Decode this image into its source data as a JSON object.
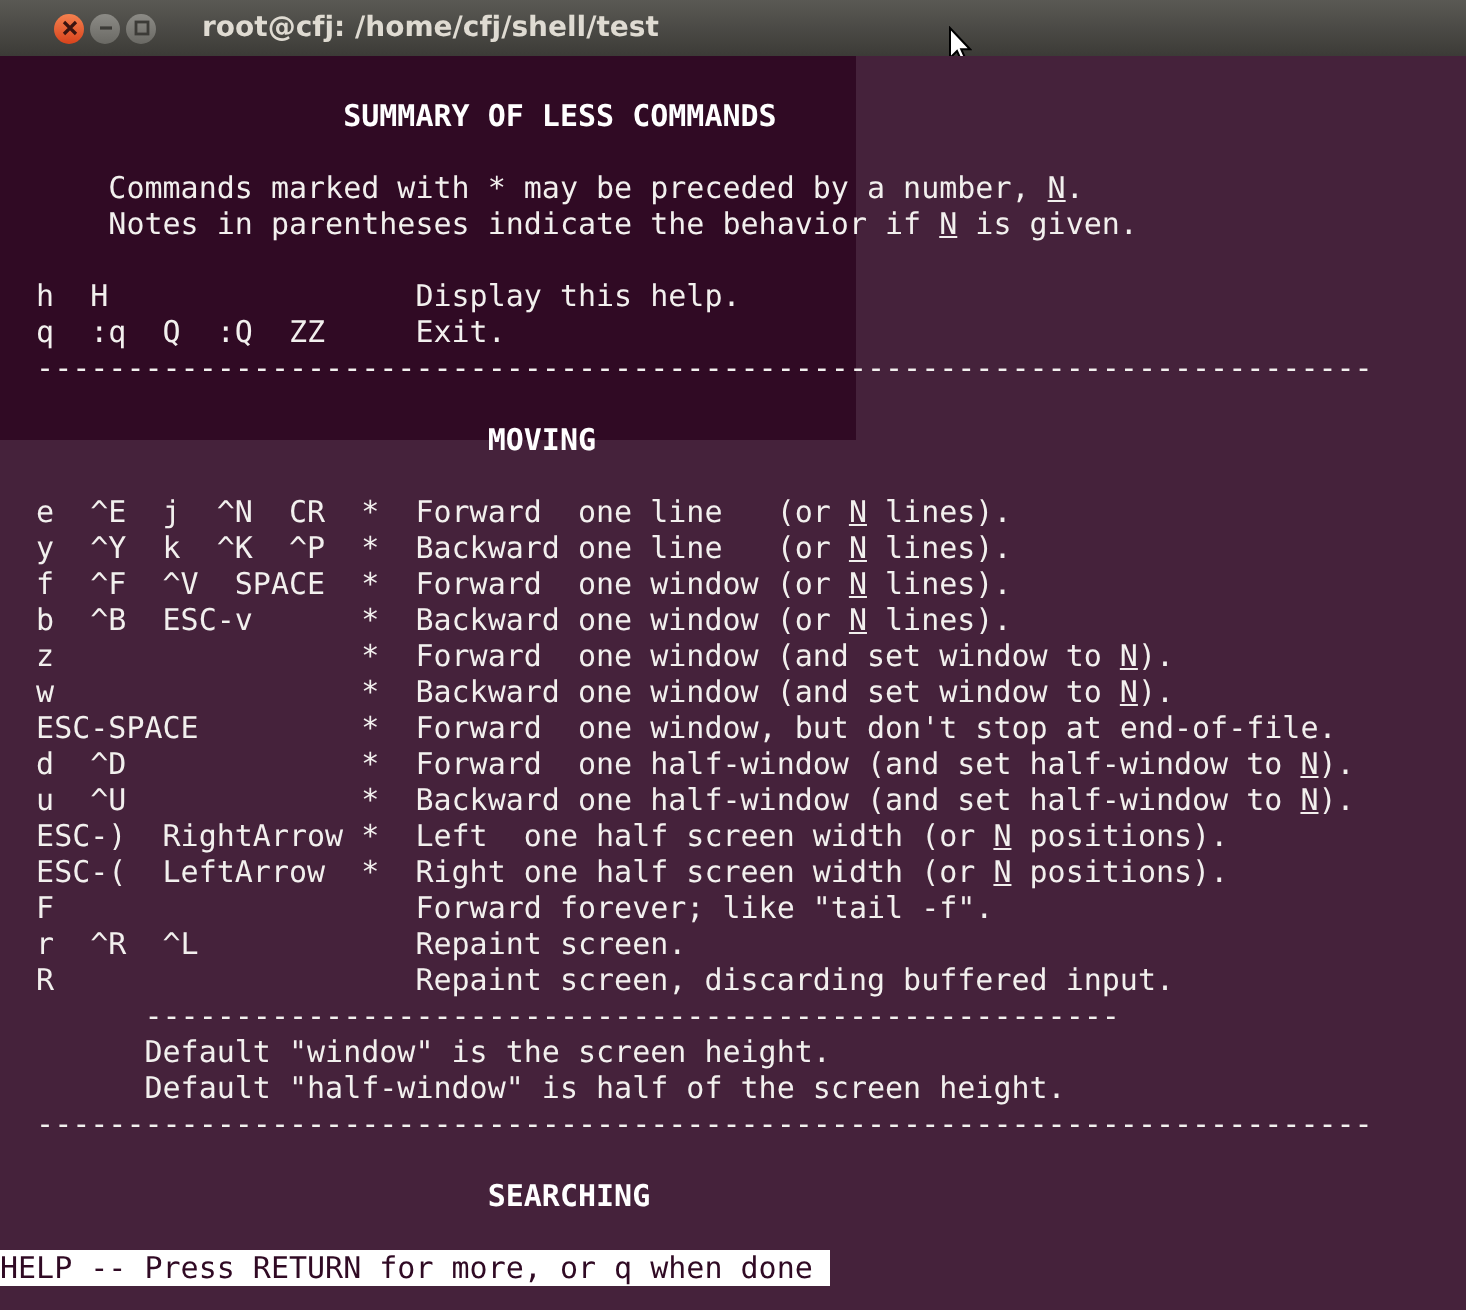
{
  "window": {
    "title": "root@cfj: /home/cfj/shell/test"
  },
  "lines": [
    {
      "kind": "blank"
    },
    {
      "kind": "heading",
      "parts": [
        {
          "text": "                   SUMMARY OF LESS COMMANDS",
          "underline": false
        }
      ]
    },
    {
      "kind": "blank"
    },
    {
      "kind": "text",
      "parts": [
        {
          "text": "      Commands marked with * may be preceded by a number, ",
          "underline": false
        },
        {
          "text": "N",
          "underline": true
        },
        {
          "text": ".",
          "underline": false
        }
      ]
    },
    {
      "kind": "text",
      "parts": [
        {
          "text": "      Notes in parentheses indicate the behavior if ",
          "underline": false
        },
        {
          "text": "N",
          "underline": true
        },
        {
          "text": " is given.",
          "underline": false
        }
      ]
    },
    {
      "kind": "blank"
    },
    {
      "kind": "text",
      "parts": [
        {
          "text": "  h  H                 Display this help.",
          "underline": false
        }
      ]
    },
    {
      "kind": "text",
      "parts": [
        {
          "text": "  q  :q  Q  :Q  ZZ     Exit.",
          "underline": false
        }
      ]
    },
    {
      "kind": "text",
      "parts": [
        {
          "text": "  --------------------------------------------------------------------------",
          "underline": false
        }
      ]
    },
    {
      "kind": "blank"
    },
    {
      "kind": "heading",
      "parts": [
        {
          "text": "                           MOVING",
          "underline": false
        }
      ]
    },
    {
      "kind": "blank"
    },
    {
      "kind": "text",
      "parts": [
        {
          "text": "  e  ^E  j  ^N  CR  *  Forward  one line   (or ",
          "underline": false
        },
        {
          "text": "N",
          "underline": true
        },
        {
          "text": " lines).",
          "underline": false
        }
      ]
    },
    {
      "kind": "text",
      "parts": [
        {
          "text": "  y  ^Y  k  ^K  ^P  *  Backward one line   (or ",
          "underline": false
        },
        {
          "text": "N",
          "underline": true
        },
        {
          "text": " lines).",
          "underline": false
        }
      ]
    },
    {
      "kind": "text",
      "parts": [
        {
          "text": "  f  ^F  ^V  SPACE  *  Forward  one window (or ",
          "underline": false
        },
        {
          "text": "N",
          "underline": true
        },
        {
          "text": " lines).",
          "underline": false
        }
      ]
    },
    {
      "kind": "text",
      "parts": [
        {
          "text": "  b  ^B  ESC-v      *  Backward one window (or ",
          "underline": false
        },
        {
          "text": "N",
          "underline": true
        },
        {
          "text": " lines).",
          "underline": false
        }
      ]
    },
    {
      "kind": "text",
      "parts": [
        {
          "text": "  z                 *  Forward  one window (and set window to ",
          "underline": false
        },
        {
          "text": "N",
          "underline": true
        },
        {
          "text": ").",
          "underline": false
        }
      ]
    },
    {
      "kind": "text",
      "parts": [
        {
          "text": "  w                 *  Backward one window (and set window to ",
          "underline": false
        },
        {
          "text": "N",
          "underline": true
        },
        {
          "text": ").",
          "underline": false
        }
      ]
    },
    {
      "kind": "text",
      "parts": [
        {
          "text": "  ESC-SPACE         *  Forward  one window, but don't stop at end-of-file.",
          "underline": false
        }
      ]
    },
    {
      "kind": "text",
      "parts": [
        {
          "text": "  d  ^D             *  Forward  one half-window (and set half-window to ",
          "underline": false
        },
        {
          "text": "N",
          "underline": true
        },
        {
          "text": ").",
          "underline": false
        }
      ]
    },
    {
      "kind": "text",
      "parts": [
        {
          "text": "  u  ^U             *  Backward one half-window (and set half-window to ",
          "underline": false
        },
        {
          "text": "N",
          "underline": true
        },
        {
          "text": ").",
          "underline": false
        }
      ]
    },
    {
      "kind": "text",
      "parts": [
        {
          "text": "  ESC-)  RightArrow *  Left  one half screen width (or ",
          "underline": false
        },
        {
          "text": "N",
          "underline": true
        },
        {
          "text": " positions).",
          "underline": false
        }
      ]
    },
    {
      "kind": "text",
      "parts": [
        {
          "text": "  ESC-(  LeftArrow  *  Right one half screen width (or ",
          "underline": false
        },
        {
          "text": "N",
          "underline": true
        },
        {
          "text": " positions).",
          "underline": false
        }
      ]
    },
    {
      "kind": "text",
      "parts": [
        {
          "text": "  F                    Forward forever; like \"tail -f\".",
          "underline": false
        }
      ]
    },
    {
      "kind": "text",
      "parts": [
        {
          "text": "  r  ^R  ^L            Repaint screen.",
          "underline": false
        }
      ]
    },
    {
      "kind": "text",
      "parts": [
        {
          "text": "  R                    Repaint screen, discarding buffered input.",
          "underline": false
        }
      ]
    },
    {
      "kind": "text",
      "parts": [
        {
          "text": "        ------------------------------------------------------",
          "underline": false
        }
      ]
    },
    {
      "kind": "text",
      "parts": [
        {
          "text": "        Default \"window\" is the screen height.",
          "underline": false
        }
      ]
    },
    {
      "kind": "text",
      "parts": [
        {
          "text": "        Default \"half-window\" is half of the screen height.",
          "underline": false
        }
      ]
    },
    {
      "kind": "text",
      "parts": [
        {
          "text": "  --------------------------------------------------------------------------",
          "underline": false
        }
      ]
    },
    {
      "kind": "blank"
    },
    {
      "kind": "heading",
      "parts": [
        {
          "text": "                           SEARCHING",
          "underline": false
        }
      ]
    },
    {
      "kind": "blank"
    },
    {
      "kind": "prompt",
      "parts": [
        {
          "text": "HELP -- Press RETURN for more, or q when done ",
          "underline": false
        }
      ]
    }
  ]
}
